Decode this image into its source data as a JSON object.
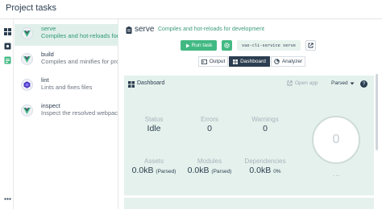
{
  "header": {
    "title": "Project tasks"
  },
  "iconbar": {
    "items": [
      {
        "icon": "dashboard-icon"
      },
      {
        "icon": "plugin-icon"
      },
      {
        "icon": "tasks-icon"
      }
    ],
    "more_icon": "more-icon"
  },
  "tasks": [
    {
      "name": "serve",
      "description": "Compiles and hot-reloads for development",
      "active": true
    },
    {
      "name": "build",
      "description": "Compiles and minifies for production",
      "active": false
    },
    {
      "name": "lint",
      "description": "Lints and fixes files",
      "active": false
    },
    {
      "name": "inspect",
      "description": "Inspect the resolved webpack config",
      "active": false
    }
  ],
  "main": {
    "title": "serve",
    "subtitle": "Compiles and hot-reloads for development",
    "run_label": "Run task",
    "command": "vue-cli-service serve",
    "tabs": [
      {
        "label": "Output",
        "active": false
      },
      {
        "label": "Dashboard",
        "active": true
      },
      {
        "label": "Analyzer",
        "active": false
      }
    ]
  },
  "dashboard": {
    "title": "Dashboard",
    "open_app": "Open app",
    "mode": "Parsed",
    "stats": {
      "status": {
        "label": "Status",
        "value": "Idle"
      },
      "errors": {
        "label": "Errors",
        "value": "0"
      },
      "warnings": {
        "label": "Warnings",
        "value": "0"
      },
      "assets": {
        "label": "Assets",
        "value": "0.0kB",
        "note": "(Parsed)"
      },
      "modules": {
        "label": "Modules",
        "value": "0.0kB",
        "note": "(Parsed)"
      },
      "dependencies": {
        "label": "Dependencies",
        "value": "0.0kB",
        "note": "0%"
      }
    },
    "progress": "0",
    "more": "..."
  },
  "colors": {
    "accent": "#42b983",
    "dark": "#2c3e50",
    "panel": "#e4f1ec"
  }
}
